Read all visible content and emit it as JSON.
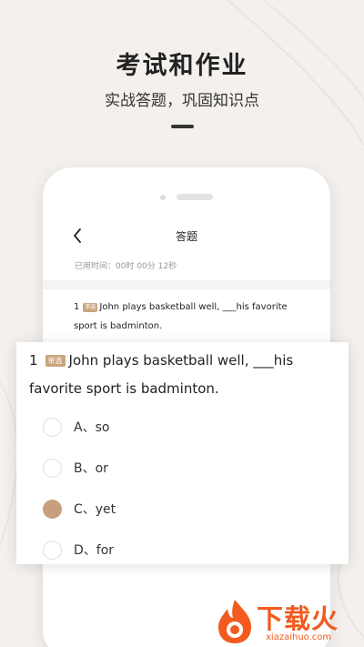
{
  "promo": {
    "title": "考试和作业",
    "subtitle": "实战答题，巩固知识点"
  },
  "screen": {
    "title": "答题",
    "timer": "已用时间：00时 00分 12秒"
  },
  "question": {
    "number": "1",
    "tag": "单选",
    "text": "John plays basketball well, ___his favorite sport is badminton.",
    "options": [
      {
        "label": "A、so",
        "selected": false
      },
      {
        "label": "B、or",
        "selected": false
      },
      {
        "label": "C、yet",
        "selected": true
      },
      {
        "label": "D、for",
        "selected": false
      }
    ]
  },
  "watermark": {
    "text": "下载火",
    "url": "xiazaihuo.com"
  },
  "colors": {
    "accent": "#c6a07c",
    "watermark": "#f25a1e",
    "background": "#f3f0ed"
  },
  "icons": {
    "back": "chevron-left-icon",
    "logo": "flame-icon"
  }
}
